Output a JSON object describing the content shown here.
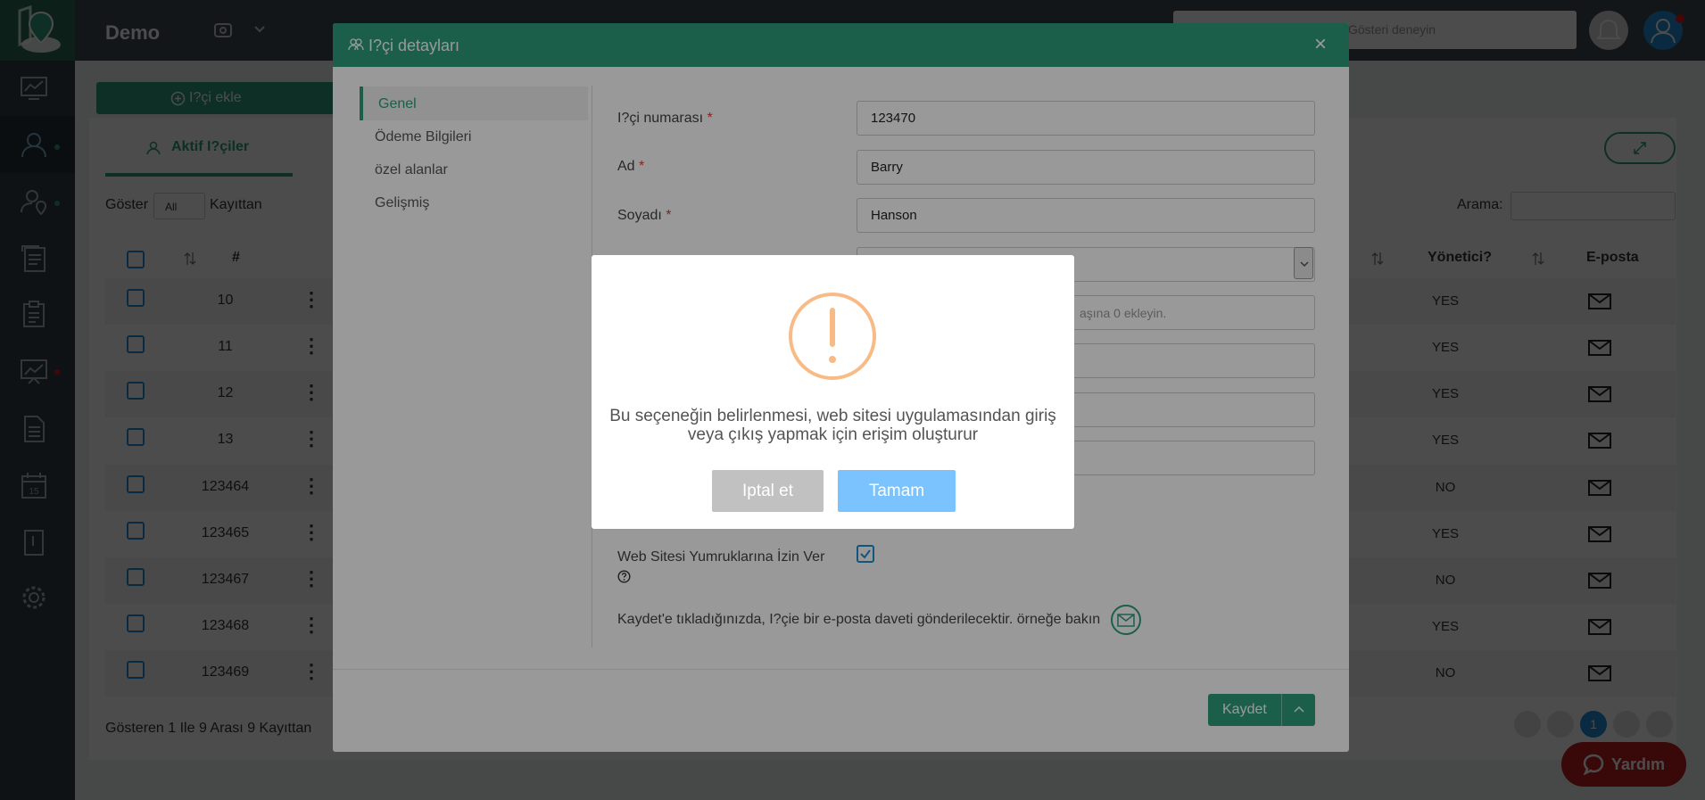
{
  "app": {
    "title": "Demo"
  },
  "topbar": {
    "search_placeholder": "Gösteri deneyin"
  },
  "page": {
    "add_button": "I?çi ekle",
    "active_tab": "Aktif I?çiler",
    "show_label": "Göster",
    "show_value": "All",
    "records_label": "Kayıttan",
    "search_label": "Arama:",
    "columns": {
      "number": "#",
      "admin": "Yönetici?",
      "email": "E-posta"
    },
    "rows": [
      {
        "id": "10",
        "admin": "YES"
      },
      {
        "id": "11",
        "admin": "YES"
      },
      {
        "id": "12",
        "admin": "YES"
      },
      {
        "id": "13",
        "admin": "YES"
      },
      {
        "id": "123464",
        "admin": "NO"
      },
      {
        "id": "123465",
        "admin": "YES"
      },
      {
        "id": "123467",
        "admin": "NO"
      },
      {
        "id": "123468",
        "admin": "YES"
      },
      {
        "id": "123469",
        "admin": "NO"
      }
    ],
    "footer_info": "Gösteren 1 Ile 9 Arası 9 Kayıttan",
    "current_page": "1",
    "help_button": "Yardım"
  },
  "modal": {
    "title": "I?çi detayları",
    "close": "×",
    "side_tabs": [
      "Genel",
      "Ödeme Bilgileri",
      "özel alanlar",
      "Gelişmiş"
    ],
    "fields": {
      "number_label": "I?çi numarası",
      "number_value": "123470",
      "name_label": "Ad",
      "name_value": "Barry",
      "surname_label": "Soyadı",
      "surname_value": "Hanson",
      "phone_hint": "aşına 0 ekleyin.",
      "required_mark": "*"
    },
    "punch_label": "Web Sitesi Yumruklarına İzin Ver",
    "invite_text": "Kaydet'e tıkladığınızda, I?çie bir e-posta daveti gönderilecektir. örneğe bakın",
    "save_button": "Kaydet"
  },
  "alert": {
    "message": "Bu seçeneğin belirlenmesi, web sitesi uygulamasından giriş veya çıkış yapmak için erişim oluşturur",
    "cancel": "Iptal et",
    "ok": "Tamam"
  },
  "colors": {
    "accent": "#2e9f7e",
    "sidebar": "#313e47",
    "alert_warning": "#f8bb86",
    "ok_button": "#7ac3ff"
  }
}
